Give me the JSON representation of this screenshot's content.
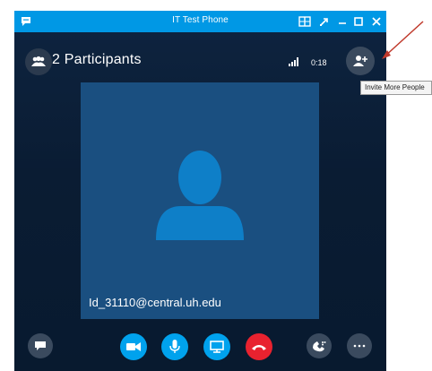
{
  "window": {
    "title": "IT Test Phone"
  },
  "call": {
    "participants_label": "2 Participants",
    "timer": "0:18",
    "tooltip": "Invite More People",
    "participant_email": "Id_31110@central.uh.edu"
  },
  "icons": {
    "app_logo": "skype-chat-icon",
    "participants": "people-icon",
    "signal": "signal-strength-icon",
    "invite": "add-person-icon",
    "im": "chat-icon",
    "video": "video-camera-icon",
    "mic": "microphone-icon",
    "share": "present-screen-icon",
    "hangup": "hang-up-icon",
    "call_controls": "phone-keypad-icon",
    "more": "more-options-icon"
  },
  "colors": {
    "titlebar": "#0098e5",
    "accent_blue": "#00a2ed",
    "hangup_red": "#e8222f",
    "video_tile": "#1a4f80",
    "annotation_arrow": "#c0392b"
  }
}
